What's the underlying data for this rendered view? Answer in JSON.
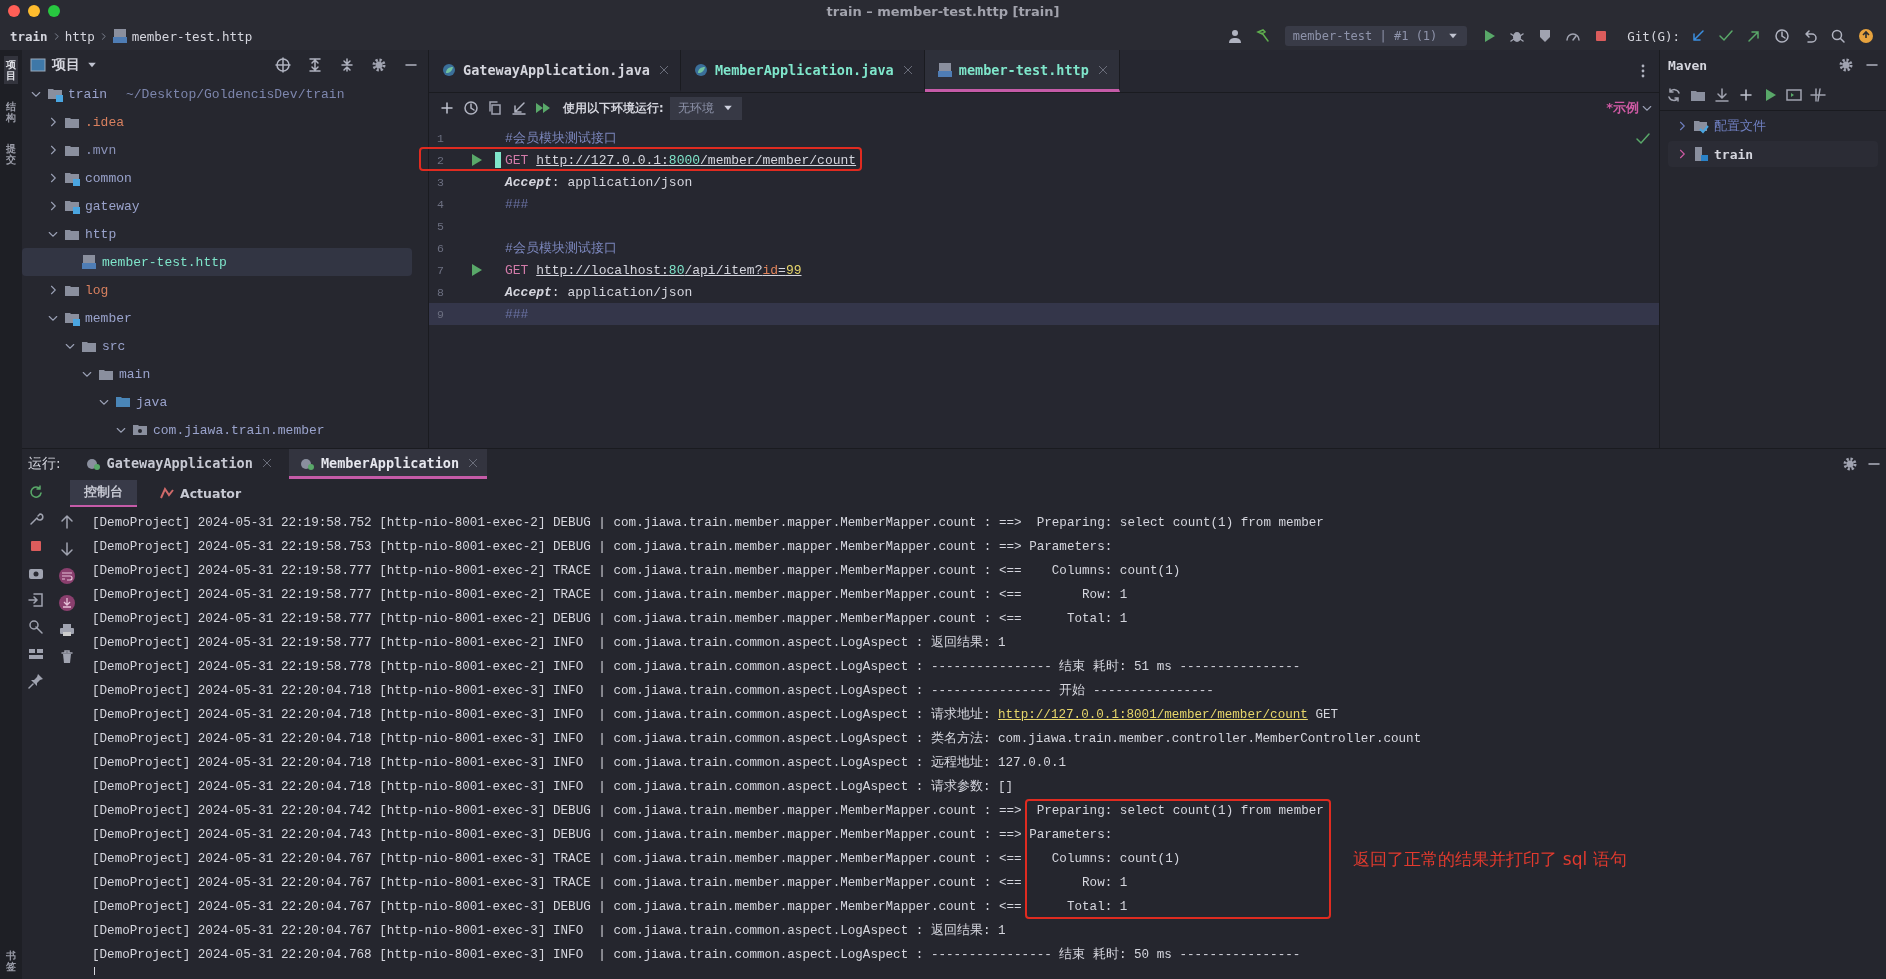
{
  "title_bar": {
    "title": "train – member-test.http [train]"
  },
  "breadcrumbs": [
    {
      "label": "train"
    },
    {
      "label": "http"
    },
    {
      "label": "member-test.http"
    }
  ],
  "toolbar": {
    "run_config": "member-test | #1 (1)",
    "git_label": "Git(G):"
  },
  "left_strip": [
    {
      "label": "项目",
      "selected": true
    },
    {
      "label": "结构",
      "selected": false
    },
    {
      "label": "提交",
      "selected": false
    }
  ],
  "left_strip_bottom": {
    "label": "书签"
  },
  "project": {
    "title": "项目",
    "tree": [
      {
        "name": "train",
        "path": "~/Desktop/GoldencisDev/train",
        "kind": "module",
        "expanded": true,
        "selected": false,
        "color": "#9aa3cc",
        "children": [
          {
            "name": ".idea",
            "kind": "folder",
            "expanded": false,
            "selected": false,
            "color": "#d8805f"
          },
          {
            "name": ".mvn",
            "kind": "folder",
            "expanded": false,
            "selected": false,
            "color": "#8a92b8"
          },
          {
            "name": "common",
            "kind": "module",
            "expanded": false,
            "selected": false,
            "color": "#9aa3cc"
          },
          {
            "name": "gateway",
            "kind": "module",
            "expanded": false,
            "selected": false,
            "color": "#9aa3cc"
          },
          {
            "name": "http",
            "kind": "folder",
            "expanded": true,
            "selected": false,
            "color": "#9aa3cc",
            "children": [
              {
                "name": "member-test.http",
                "kind": "file",
                "selected": true,
                "color": "#7fe6cb"
              }
            ]
          },
          {
            "name": "log",
            "kind": "folder",
            "expanded": false,
            "selected": false,
            "color": "#d8805f"
          },
          {
            "name": "member",
            "kind": "module",
            "expanded": true,
            "selected": false,
            "color": "#9aa3cc",
            "children": [
              {
                "name": "src",
                "kind": "folder",
                "expanded": true,
                "selected": false,
                "color": "#9aa3cc",
                "children": [
                  {
                    "name": "main",
                    "kind": "folder",
                    "expanded": true,
                    "selected": false,
                    "color": "#9aa3cc",
                    "children": [
                      {
                        "name": "java",
                        "kind": "source",
                        "expanded": true,
                        "selected": false,
                        "color": "#9aa3cc",
                        "children": [
                          {
                            "name": "com.jiawa.train.member",
                            "kind": "package",
                            "expanded": true,
                            "selected": false,
                            "color": "#9aa3cc"
                          }
                        ]
                      }
                    ]
                  }
                ]
              }
            ]
          }
        ]
      }
    ]
  },
  "editor": {
    "tabs": [
      {
        "label": "GatewayApplication.java",
        "kind": "java",
        "selected": false,
        "color": "#d5d6de"
      },
      {
        "label": "MemberApplication.java",
        "kind": "java",
        "selected": false,
        "color": "#7fe6cb"
      },
      {
        "label": "member-test.http",
        "kind": "http",
        "selected": true,
        "color": "#7fe6cb"
      }
    ],
    "env_label": "使用以下环境运行:",
    "env_value": "无环境",
    "examples": "*示例",
    "lines": [
      {
        "number": "1",
        "kind": "comment",
        "text": "#会员模块测试接口",
        "runnable": false,
        "highlighted": false,
        "current": false,
        "caret": false
      },
      {
        "number": "2",
        "kind": "request",
        "method": "GET",
        "url": [
          {
            "text": "http://127.0.0.1:",
            "kind": "host"
          },
          {
            "text": "8000",
            "kind": "port"
          },
          {
            "text": "/member/member/count",
            "kind": "path"
          }
        ],
        "runnable": true,
        "highlighted": true,
        "current": false,
        "caret": true
      },
      {
        "number": "3",
        "kind": "header",
        "name": "Accept",
        "value": ": application/json",
        "runnable": false,
        "highlighted": false,
        "current": false,
        "caret": false
      },
      {
        "number": "4",
        "kind": "separator",
        "text": "###",
        "runnable": false,
        "highlighted": false,
        "current": false,
        "caret": false
      },
      {
        "number": "5",
        "kind": "blank",
        "runnable": false,
        "highlighted": false,
        "current": false,
        "caret": false
      },
      {
        "number": "6",
        "kind": "comment",
        "text": "#会员模块测试接口",
        "runnable": false,
        "highlighted": false,
        "current": false,
        "caret": false
      },
      {
        "number": "7",
        "kind": "request",
        "method": "GET",
        "url": [
          {
            "text": "http://localhost:",
            "kind": "host"
          },
          {
            "text": "80",
            "kind": "port"
          },
          {
            "text": "/api/item?",
            "kind": "path"
          },
          {
            "text": "id",
            "kind": "param"
          },
          {
            "text": "=",
            "kind": "path"
          },
          {
            "text": "99",
            "kind": "value"
          }
        ],
        "runnable": true,
        "highlighted": false,
        "current": false,
        "caret": false
      },
      {
        "number": "8",
        "kind": "header",
        "name": "Accept",
        "value": ": application/json",
        "runnable": false,
        "highlighted": false,
        "current": false,
        "caret": false
      },
      {
        "number": "9",
        "kind": "separator",
        "text": "###",
        "runnable": false,
        "highlighted": false,
        "current": true,
        "caret": false
      }
    ]
  },
  "maven": {
    "title": "Maven",
    "items": [
      {
        "label": "配置文件",
        "kind": "profiles"
      },
      {
        "label": "train",
        "kind": "project"
      }
    ]
  },
  "run": {
    "label": "运行:",
    "tabs": [
      {
        "label": "GatewayApplication",
        "selected": false
      },
      {
        "label": "MemberApplication",
        "selected": true
      }
    ],
    "console_tabs": [
      {
        "label": "控制台",
        "kind": "console",
        "selected": true
      },
      {
        "label": "Actuator",
        "kind": "actuator",
        "selected": false
      }
    ],
    "note": "返回了正常的结果并打印了 sql 语句",
    "log": [
      {
        "source": "[DemoProject] 2024-05-31 22:19:58.752 [http-nio-8001-exec-2] DEBUG | com.jiawa.train.member.mapper.MemberMapper.count : ==>",
        "message": " Preparing: select count(1) from member",
        "highlighted": false
      },
      {
        "source": "[DemoProject] 2024-05-31 22:19:58.753 [http-nio-8001-exec-2] DEBUG | com.jiawa.train.member.mapper.MemberMapper.count : ==>",
        "message": "Parameters:",
        "highlighted": false
      },
      {
        "source": "[DemoProject] 2024-05-31 22:19:58.777 [http-nio-8001-exec-2] TRACE | com.jiawa.train.member.mapper.MemberMapper.count : <==",
        "message": "   Columns: count(1)",
        "highlighted": false
      },
      {
        "source": "[DemoProject] 2024-05-31 22:19:58.777 [http-nio-8001-exec-2] TRACE | com.jiawa.train.member.mapper.MemberMapper.count : <==",
        "message": "       Row: 1",
        "highlighted": false
      },
      {
        "source": "[DemoProject] 2024-05-31 22:19:58.777 [http-nio-8001-exec-2] DEBUG | com.jiawa.train.member.mapper.MemberMapper.count : <==",
        "message": "     Total: 1",
        "highlighted": false
      },
      {
        "source": "[DemoProject] 2024-05-31 22:19:58.777 [http-nio-8001-exec-2] INFO  | com.jiawa.train.common.aspect.LogAspect :",
        "message": "返回结果: 1",
        "highlighted": false
      },
      {
        "source": "[DemoProject] 2024-05-31 22:19:58.778 [http-nio-8001-exec-2] INFO  | com.jiawa.train.common.aspect.LogAspect :",
        "message": "---------------- 结束 耗时: 51 ms ----------------",
        "highlighted": false
      },
      {
        "source": "[DemoProject] 2024-05-31 22:20:04.718 [http-nio-8001-exec-3] INFO  | com.jiawa.train.common.aspect.LogAspect :",
        "message": "---------------- 开始 ----------------",
        "highlighted": false
      },
      {
        "source": "[DemoProject] 2024-05-31 22:20:04.718 [http-nio-8001-exec-3] INFO  | com.jiawa.train.common.aspect.LogAspect :",
        "message": "请求地址:",
        "link": "http://127.0.0.1:8001/member/member/count",
        "after": "GET",
        "highlighted": false
      },
      {
        "source": "[DemoProject] 2024-05-31 22:20:04.718 [http-nio-8001-exec-3] INFO  | com.jiawa.train.common.aspect.LogAspect :",
        "message": "类名方法: com.jiawa.train.member.controller.MemberController.count",
        "highlighted": false
      },
      {
        "source": "[DemoProject] 2024-05-31 22:20:04.718 [http-nio-8001-exec-3] INFO  | com.jiawa.train.common.aspect.LogAspect :",
        "message": "远程地址: 127.0.0.1",
        "highlighted": false
      },
      {
        "source": "[DemoProject] 2024-05-31 22:20:04.718 [http-nio-8001-exec-3] INFO  | com.jiawa.train.common.aspect.LogAspect :",
        "message": "请求参数: []",
        "highlighted": false
      },
      {
        "source": "[DemoProject] 2024-05-31 22:20:04.742 [http-nio-8001-exec-3] DEBUG | com.jiawa.train.member.mapper.MemberMapper.count : ==>",
        "message": " Preparing: select count(1) from member",
        "highlighted": true
      },
      {
        "source": "[DemoProject] 2024-05-31 22:20:04.743 [http-nio-8001-exec-3] DEBUG | com.jiawa.train.member.mapper.MemberMapper.count : ==>",
        "message": "Parameters:",
        "highlighted": true
      },
      {
        "source": "[DemoProject] 2024-05-31 22:20:04.767 [http-nio-8001-exec-3] TRACE | com.jiawa.train.member.mapper.MemberMapper.count : <==",
        "message": "   Columns: count(1)",
        "highlighted": true
      },
      {
        "source": "[DemoProject] 2024-05-31 22:20:04.767 [http-nio-8001-exec-3] TRACE | com.jiawa.train.member.mapper.MemberMapper.count : <==",
        "message": "       Row: 1",
        "highlighted": true
      },
      {
        "source": "[DemoProject] 2024-05-31 22:20:04.767 [http-nio-8001-exec-3] DEBUG | com.jiawa.train.member.mapper.MemberMapper.count : <==",
        "message": "     Total: 1",
        "highlighted": true
      },
      {
        "source": "[DemoProject] 2024-05-31 22:20:04.767 [http-nio-8001-exec-3] INFO  | com.jiawa.train.common.aspect.LogAspect :",
        "message": "返回结果: 1",
        "highlighted": false
      },
      {
        "source": "[DemoProject] 2024-05-31 22:20:04.768 [http-nio-8001-exec-3] INFO  | com.jiawa.train.common.aspect.LogAspect :",
        "message": "---------------- 结束 耗时: 50 ms ----------------",
        "highlighted": false
      }
    ]
  }
}
